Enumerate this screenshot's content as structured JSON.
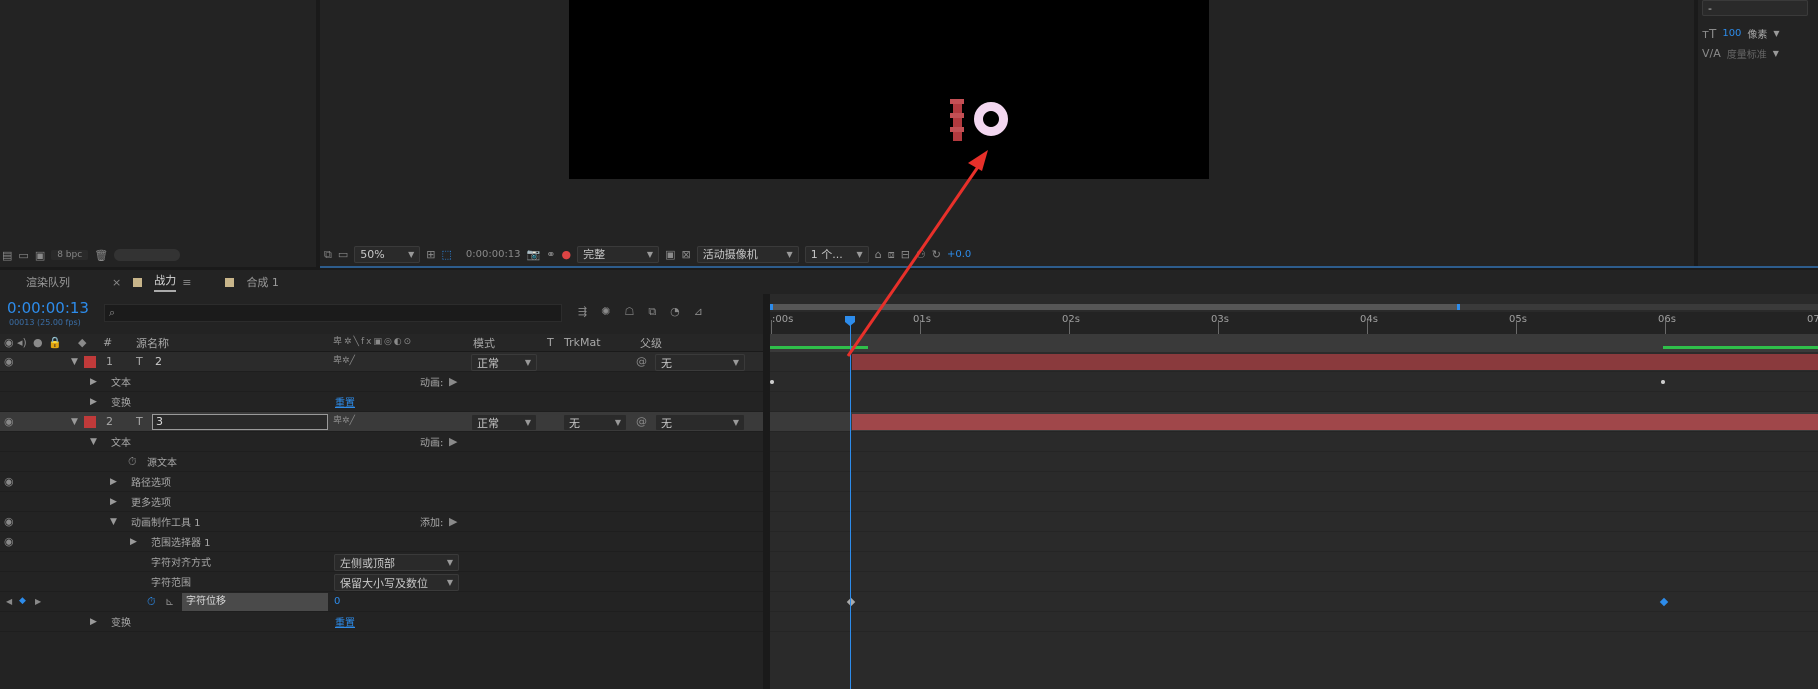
{
  "top_left_panel": {
    "bpc_label": "8 bpc"
  },
  "viewer_toolbar": {
    "zoom": "50%",
    "timecode": "0:00:00:13",
    "resolution": "完整",
    "camera": "活动摄像机",
    "views": "1 个...",
    "exposure": "+0.0"
  },
  "character_panel": {
    "top_field": "-",
    "size_value": "100",
    "size_unit": "像素",
    "tracking_label": "度量标准"
  },
  "tabs": [
    {
      "label": "渲染队列"
    },
    {
      "label": "战力"
    },
    {
      "label": "合成 1"
    }
  ],
  "timeline": {
    "current_time": "0:00:00:13",
    "frame_info": "00013 (25.00 fps)",
    "search_placeholder": "",
    "ruler_labels": [
      ":00s",
      "01s",
      "02s",
      "03s",
      "04s",
      "05s",
      "06s",
      "07"
    ],
    "col_headers": {
      "num": "#",
      "source_name": "源名称",
      "mode": "模式",
      "t": "T",
      "trkmat": "TrkMat",
      "parent": "父级"
    }
  },
  "layers": [
    {
      "num": "1",
      "name": "2",
      "mode": "正常",
      "trkmat": "",
      "parent": "无",
      "color": "#c03a3a"
    },
    {
      "num": "2",
      "name": "3",
      "mode": "正常",
      "trkmat": "无",
      "parent": "无",
      "color": "#c03a3a"
    }
  ],
  "props": {
    "text": "文本",
    "animate": "动画:",
    "transform": "变换",
    "reset": "重置",
    "source_text": "源文本",
    "path_options": "路径选项",
    "more_options": "更多选项",
    "animator": "动画制作工具 1",
    "add": "添加:",
    "range_selector": "范围选择器 1",
    "char_align": "字符对齐方式",
    "char_align_value": "左侧或顶部",
    "char_range": "字符范围",
    "char_range_value": "保留大小写及数位",
    "char_offset": "字符位移",
    "char_offset_value": "0"
  },
  "canvas_text": {
    "glyph": "O"
  },
  "colors": {
    "accent": "#2d8ceb",
    "layer_bar": "#8a3a3d",
    "arrow": "#e8302a",
    "work_green": "#2fbf4a"
  }
}
